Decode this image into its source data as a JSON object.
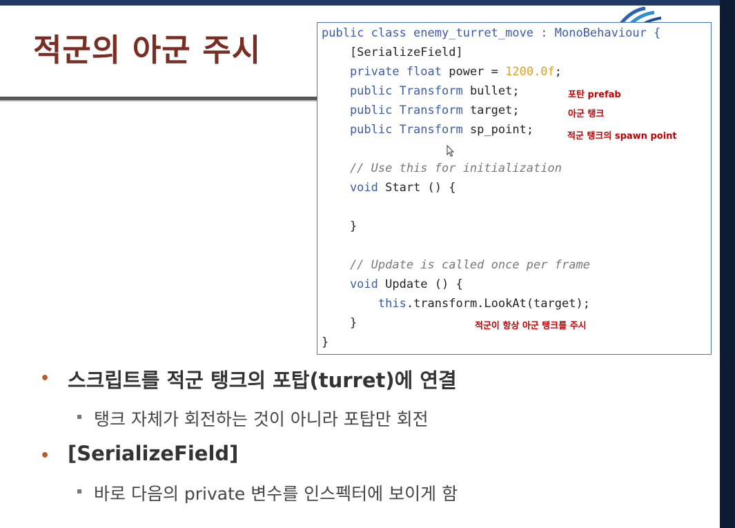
{
  "slide": {
    "title": "적군의 아군 주시"
  },
  "code": {
    "lines": [
      {
        "parts": [
          {
            "t": "public class enemy_turret_move : MonoBehaviour {",
            "c": "kw"
          }
        ]
      },
      {
        "parts": [
          {
            "t": "    [SerializeField]",
            "c": ""
          }
        ]
      },
      {
        "parts": [
          {
            "t": "    private float ",
            "c": "kw"
          },
          {
            "t": "power = ",
            "c": ""
          },
          {
            "t": "1200.0f",
            "c": "num"
          },
          {
            "t": ";",
            "c": ""
          }
        ]
      },
      {
        "parts": [
          {
            "t": "    public Transform ",
            "c": "kw"
          },
          {
            "t": "bullet;",
            "c": ""
          }
        ]
      },
      {
        "parts": [
          {
            "t": "    public Transform ",
            "c": "kw"
          },
          {
            "t": "target;",
            "c": ""
          }
        ]
      },
      {
        "parts": [
          {
            "t": "    public Transform ",
            "c": "kw"
          },
          {
            "t": "sp_point;",
            "c": ""
          }
        ]
      },
      {
        "parts": [
          {
            "t": "",
            "c": ""
          }
        ]
      },
      {
        "parts": [
          {
            "t": "    // Use this for initialization",
            "c": "cmt"
          }
        ]
      },
      {
        "parts": [
          {
            "t": "    void ",
            "c": "kw"
          },
          {
            "t": "Start () {",
            "c": ""
          }
        ]
      },
      {
        "parts": [
          {
            "t": "",
            "c": ""
          }
        ]
      },
      {
        "parts": [
          {
            "t": "    }",
            "c": ""
          }
        ]
      },
      {
        "parts": [
          {
            "t": "",
            "c": ""
          }
        ]
      },
      {
        "parts": [
          {
            "t": "    // Update is called once per frame",
            "c": "cmt"
          }
        ]
      },
      {
        "parts": [
          {
            "t": "    void ",
            "c": "kw"
          },
          {
            "t": "Update () {",
            "c": ""
          }
        ]
      },
      {
        "parts": [
          {
            "t": "        this",
            "c": "kw"
          },
          {
            "t": ".transform.LookAt(target);",
            "c": ""
          }
        ]
      },
      {
        "parts": [
          {
            "t": "    }",
            "c": ""
          }
        ]
      },
      {
        "parts": [
          {
            "t": "}",
            "c": ""
          }
        ]
      }
    ],
    "notes": {
      "bullet": "포탄 prefab",
      "target": "아군 탱크",
      "sp_point": "적군 탱크의 spawn point",
      "lookat": "적군이 항상 아군 탱크를 주시"
    }
  },
  "bullets": [
    {
      "text": "스크립트를 적군 탱크의 포탑(turret)에 연결",
      "sub": "탱크 자체가 회전하는 것이 아니라 포탑만 회전"
    },
    {
      "text": "[SerializeField]",
      "sub": "바로 다음의 private 변수를 인스펙터에 보이게 함"
    }
  ],
  "colors": {
    "title": "#7a2d22",
    "keyword": "#3b5ba5",
    "number": "#e0a020",
    "note": "#c00000",
    "bullet_dot": "#b85a30"
  }
}
